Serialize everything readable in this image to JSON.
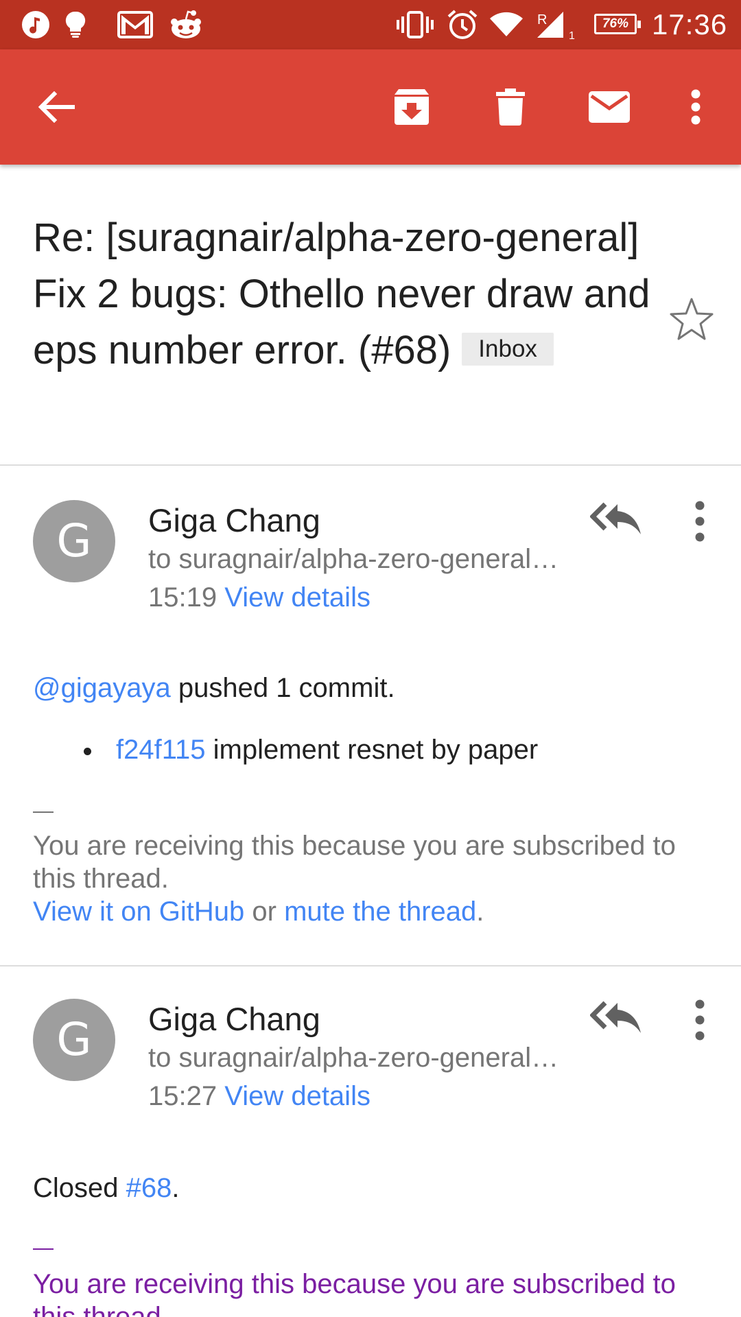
{
  "status_bar": {
    "icons": [
      "music-icon",
      "lightbulb-icon",
      "gmail-icon",
      "reddit-icon",
      "vibrate-icon",
      "alarm-icon",
      "wifi-icon",
      "signal-icon"
    ],
    "signal_roaming": "R",
    "signal_sub": "1",
    "battery": "76%",
    "time": "17:36"
  },
  "toolbar": {
    "icons": [
      "back-arrow-icon",
      "archive-icon",
      "delete-icon",
      "mark-unread-icon",
      "more-vert-icon"
    ]
  },
  "subject": {
    "text": "Re: [suragnair/alpha-zero-general] Fix 2 bugs: Othello never draw and eps number error. (#68)",
    "label": "Inbox"
  },
  "messages": [
    {
      "avatar_letter": "G",
      "sender": "Giga Chang",
      "recipient": "to suragnair/alpha-zero-general…",
      "time": "15:19",
      "details_link": "View details",
      "mention": "@gigayaya",
      "body": " pushed 1 commit.",
      "commit_hash": "f24f115",
      "commit_message": " implement resnet by paper",
      "footer": "You are receiving this because you are subscribed to this thread.",
      "github_link": "View it on GitHub",
      "or_text": " or ",
      "mute_link": "mute the thread",
      "period": "."
    },
    {
      "avatar_letter": "G",
      "sender": "Giga Chang",
      "recipient": "to suragnair/alpha-zero-general…",
      "time": "15:27",
      "details_link": "View details",
      "body_prefix": "Closed ",
      "issue_link": "#68",
      "period": ".",
      "footer": "You are receiving this because you are subscribed to this thread."
    }
  ],
  "colors": {
    "status_bar": "#b93221",
    "toolbar": "#db4437",
    "link": "#4285f4",
    "visited": "#7b1fa2",
    "avatar": "#9e9e9e"
  }
}
